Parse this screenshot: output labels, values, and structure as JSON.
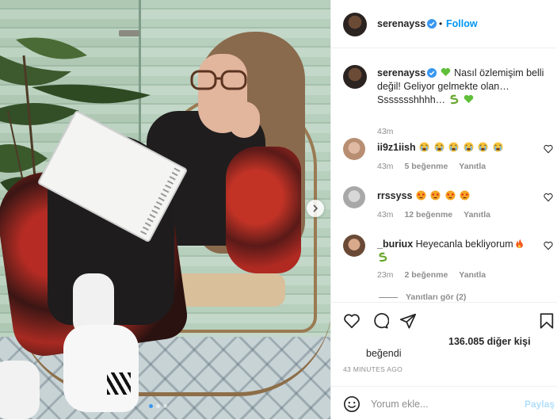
{
  "post": {
    "username": "serenayss",
    "follow_label": "Follow",
    "separator": "•",
    "caption": {
      "text_part1": "Nasıl özlemişim belli değil! Geliyor gelmekte olan… Ssssssshhhh…",
      "time": "43m"
    },
    "comments": [
      {
        "username": "ii9z1iish",
        "time": "43m",
        "likes": "5 beğenme",
        "reply": "Yanıtla"
      },
      {
        "username": "rrssyss",
        "time": "43m",
        "likes": "12 beğenme",
        "reply": "Yanıtla"
      },
      {
        "username": "_buriux",
        "text": "Heyecanla bekliyorum",
        "time": "23m",
        "likes": "2 beğenme",
        "reply": "Yanıtla"
      }
    ],
    "view_replies": "Yanıtları gör (2)",
    "likes_count": "136.085 diğer kişi",
    "liked_label": "beğendi",
    "time_ago": "43 MINUTES AGO",
    "comment_placeholder": "Yorum ekle...",
    "post_button": "Paylaş"
  },
  "icons": {
    "verified": "verified-badge-icon",
    "heart": "heart-icon",
    "comment": "comment-icon",
    "share": "share-icon",
    "save": "bookmark-icon",
    "smiley": "smiley-icon",
    "next": "chevron-right-icon"
  },
  "colors": {
    "link_blue": "#0095f6",
    "muted": "#8e8e8e",
    "post_disabled": "#b2dffc"
  }
}
